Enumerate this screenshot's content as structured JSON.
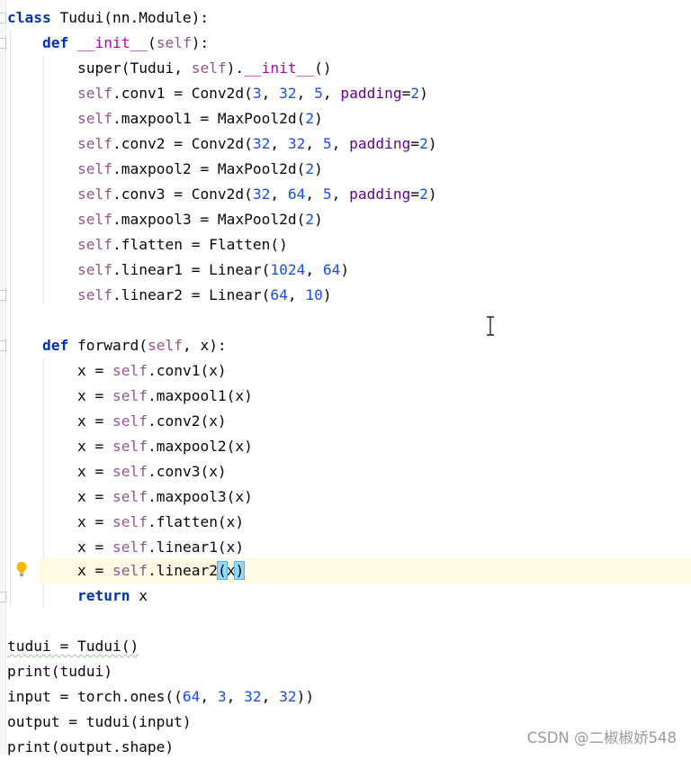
{
  "editor": {
    "language": "python",
    "colors": {
      "keyword": "#0033b3",
      "self": "#94558d",
      "number": "#1750eb",
      "keyword_argument": "#660099",
      "dunder": "#b200b2",
      "current_line_highlight": "#fffae3",
      "bracket_match": "#93d9ff"
    },
    "intention_bulb_icon": "lightbulb-icon",
    "cursor_icon": "text-cursor-ibeam-icon"
  },
  "code": {
    "l01": {
      "kw": "class",
      "rest": " Tudui(nn.Module):"
    },
    "l02": {
      "kw": "def",
      "name": "__init__",
      "p1": "(",
      "self": "self",
      "p2": "):"
    },
    "l03": {
      "a": "super(Tudui, ",
      "self": "self",
      "b": ").",
      "dunder": "__init__",
      "c": "()"
    },
    "l04": {
      "self": "self",
      "attr": ".conv1 = Conv2d(",
      "n1": "3",
      "s1": ", ",
      "n2": "32",
      "s2": ", ",
      "n3": "5",
      "s3": ", ",
      "kwarg": "padding",
      "eq": "=",
      "n4": "2",
      "end": ")"
    },
    "l05": {
      "self": "self",
      "attr": ".maxpool1 = MaxPool2d(",
      "n1": "2",
      "end": ")"
    },
    "l06": {
      "self": "self",
      "attr": ".conv2 = Conv2d(",
      "n1": "32",
      "s1": ", ",
      "n2": "32",
      "s2": ", ",
      "n3": "5",
      "s3": ", ",
      "kwarg": "padding",
      "eq": "=",
      "n4": "2",
      "end": ")"
    },
    "l07": {
      "self": "self",
      "attr": ".maxpool2 = MaxPool2d(",
      "n1": "2",
      "end": ")"
    },
    "l08": {
      "self": "self",
      "attr": ".conv3 = Conv2d(",
      "n1": "32",
      "s1": ", ",
      "n2": "64",
      "s2": ", ",
      "n3": "5",
      "s3": ", ",
      "kwarg": "padding",
      "eq": "=",
      "n4": "2",
      "end": ")"
    },
    "l09": {
      "self": "self",
      "attr": ".maxpool3 = MaxPool2d(",
      "n1": "2",
      "end": ")"
    },
    "l10": {
      "self": "self",
      "attr": ".flatten = Flatten()"
    },
    "l11": {
      "self": "self",
      "attr": ".linear1 = Linear(",
      "n1": "1024",
      "s1": ", ",
      "n2": "64",
      "end": ")"
    },
    "l12": {
      "self": "self",
      "attr": ".linear2 = Linear(",
      "n1": "64",
      "s1": ", ",
      "n2": "10",
      "end": ")"
    },
    "l13": {
      "kw": "def",
      "name": " forward(",
      "self": "self",
      "rest": ", x):"
    },
    "l14": {
      "a": "x = ",
      "self": "self",
      "b": ".conv1(x)"
    },
    "l15": {
      "a": "x = ",
      "self": "self",
      "b": ".maxpool1(x)"
    },
    "l16": {
      "a": "x = ",
      "self": "self",
      "b": ".conv2(x)"
    },
    "l17": {
      "a": "x = ",
      "self": "self",
      "b": ".maxpool2(x)"
    },
    "l18": {
      "a": "x = ",
      "self": "self",
      "b": ".conv3(x)"
    },
    "l19": {
      "a": "x = ",
      "self": "self",
      "b": ".maxpool3(x)"
    },
    "l20": {
      "a": "x = ",
      "self": "self",
      "b": ".flatten(x)"
    },
    "l21": {
      "a": "x = ",
      "self": "self",
      "b": ".linear1(x)"
    },
    "l22": {
      "a": "x = ",
      "self": "self",
      "b": ".linear2",
      "open": "(",
      "arg": "x",
      "close": ")"
    },
    "l23": {
      "kw": "return",
      "rest": " x"
    },
    "l24": {
      "rest": "tudui = Tudui()"
    },
    "l25": {
      "rest": "print(tudui)"
    },
    "l26": {
      "a": "input = torch.ones((",
      "n1": "64",
      "s1": ", ",
      "n2": "3",
      "s2": ", ",
      "n3": "32",
      "s3": ", ",
      "n4": "32",
      "end": "))"
    },
    "l27": {
      "rest": "output = tudui(input)"
    },
    "l28": {
      "rest": "print(output.shape)"
    }
  },
  "watermark": "CSDN @二椒椒娇548"
}
